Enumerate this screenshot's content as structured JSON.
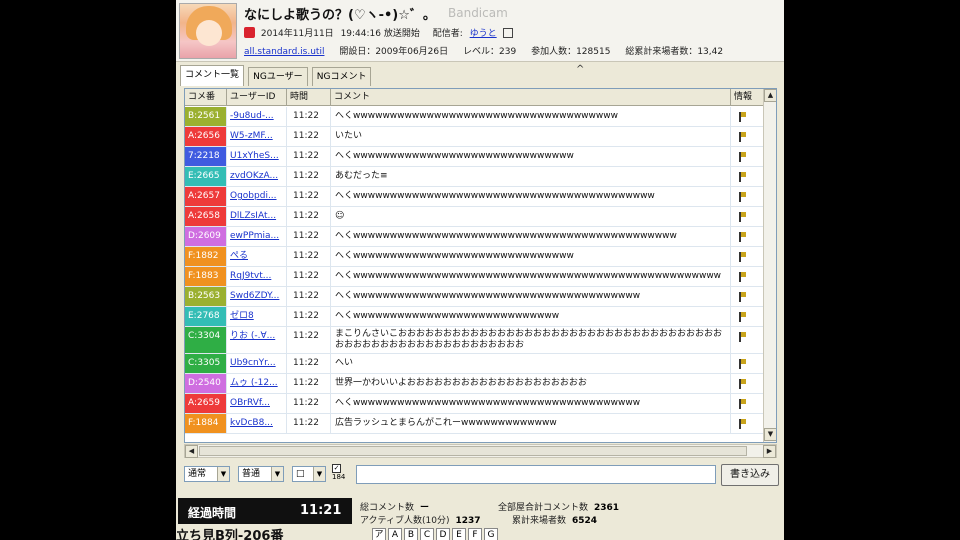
{
  "header": {
    "title": "なにしよ歌うの？(♡ヽ-•)☆゛。",
    "watermark": "Bandicam",
    "date": "2014年11月11日",
    "start_time": "19:44:16 放送開始",
    "broadcaster_label": "配信者:",
    "broadcaster": "ゆうと",
    "community": "all.standard.is.util",
    "opened": "開設日：2009年06月26日",
    "level": "レベル：239",
    "members": "参加人数：128515",
    "total_visitors": "総累計来場者数：13,42"
  },
  "tabs": [
    "コメント一覧",
    "NGユーザー",
    "NGコメント"
  ],
  "sort_indicator": "^",
  "grid": {
    "columns": [
      "コメ番",
      "ユーザーID",
      "時間",
      "コメント",
      "情報"
    ],
    "rows": [
      {
        "no": "B:2561",
        "color": "#9bb030",
        "uid": "-9u8ud-...",
        "time": "11:22",
        "comment": "へくwwwwwwwwwwwwwwwwwwwwwwwwwwwwwwwwwwww",
        "tall": false
      },
      {
        "no": "A:2656",
        "color": "#ee3a3a",
        "uid": "W5-zMF...",
        "time": "11:22",
        "comment": "いたい",
        "tall": false
      },
      {
        "no": "7:2218",
        "color": "#3f5be0",
        "uid": "U1xYheS...",
        "time": "11:22",
        "comment": "へくwwwwwwwwwwwwwwwwwwwwwwwwwwwwww",
        "tall": false
      },
      {
        "no": "E:2665",
        "color": "#33bdb5",
        "uid": "zvdOKzA...",
        "time": "11:22",
        "comment": "あむだった≡",
        "tall": false
      },
      {
        "no": "A:2657",
        "color": "#ee3a3a",
        "uid": "Ogobpdi...",
        "time": "11:22",
        "comment": "へくwwwwwwwwwwwwwwwwwwwwwwwwwwwwwwwwwwwwwwwww",
        "tall": false
      },
      {
        "no": "A:2658",
        "color": "#ee3a3a",
        "uid": "DlLZsIAt...",
        "time": "11:22",
        "comment": "☺",
        "tall": false
      },
      {
        "no": "D:2609",
        "color": "#cf6ee0",
        "uid": "ewPPmia...",
        "time": "11:22",
        "comment": "へくwwwwwwwwwwwwwwwwwwwwwwwwwwwwwwwwwwwwwwwwwwww",
        "tall": false
      },
      {
        "no": "F:1882",
        "color": "#f0911f",
        "uid": "ぺる",
        "time": "11:22",
        "comment": "へくwwwwwwwwwwwwwwwwwwwwwwwwwwwwww",
        "tall": false
      },
      {
        "no": "F:1883",
        "color": "#f0911f",
        "uid": "RqJ9tvt...",
        "time": "11:22",
        "comment": "へくwwwwwwwwwwwwwwwwwwwwwwwwwwwwwwwwwwwwwwwwwwwwwwwwww",
        "tall": false
      },
      {
        "no": "B:2563",
        "color": "#9bb030",
        "uid": "Swd6ZDY...",
        "time": "11:22",
        "comment": "へくwwwwwwwwwwwwwwwwwwwwwwwwwwwwwwwwwwwwwww",
        "tall": false
      },
      {
        "no": "E:2768",
        "color": "#33bdb5",
        "uid": "ゼロ8",
        "time": "11:22",
        "comment": "へくwwwwwwwwwwwwwwwwwwwwwwwwwwww",
        "tall": false
      },
      {
        "no": "C:3304",
        "color": "#2fae45",
        "uid": "りお (-.∀...",
        "time": "11:22",
        "comment": "まこりんさいこおおおおおおおおおおおおおおおおおおおおおおおおおおおおおおおおおおおおおおおおおおおおおおおおおおおおおおおおお",
        "tall": true
      },
      {
        "no": "C:3305",
        "color": "#2fae45",
        "uid": "Ub9cnYr...",
        "time": "11:22",
        "comment": "へい",
        "tall": false
      },
      {
        "no": "D:2540",
        "color": "#cf6ee0",
        "uid": "ムゥ (-12...",
        "time": "11:22",
        "comment": "世界一かわいいよおおおおおおおおおおおおおおおおおおおお",
        "tall": false
      },
      {
        "no": "A:2659",
        "color": "#ee3a3a",
        "uid": "OBrRVf...",
        "time": "11:22",
        "comment": "へくwwwwwwwwwwwwwwwwwwwwwwwwwwwwwwwwwwwwwww",
        "tall": false
      },
      {
        "no": "F:1884",
        "color": "#f0911f",
        "uid": "kvDcB8...",
        "time": "11:22",
        "comment": "広告ラッシュとまらんがこれーwwwwwwwwwwwww",
        "tall": false
      }
    ]
  },
  "input_bar": {
    "mode": "通常",
    "size": "普通",
    "color": "□",
    "checkbox_label": "184",
    "comment_value": "",
    "send_label": "書き込み"
  },
  "footer": {
    "elapsed_label": "経過時間",
    "elapsed_value": "11:21",
    "total_comments_label": "総コメント数",
    "total_comments_value": "ー",
    "all_rooms_label": "全部屋合計コメント数",
    "all_rooms_value": "2361",
    "active_label": "アクティブ人数(10分)",
    "active_value": "1237",
    "cumulative_label": "累計来場者数",
    "cumulative_value": "6524",
    "seat": "立ち見B列-206番",
    "room_letters": [
      "ア",
      "A",
      "B",
      "C",
      "D",
      "E",
      "F",
      "G"
    ]
  }
}
